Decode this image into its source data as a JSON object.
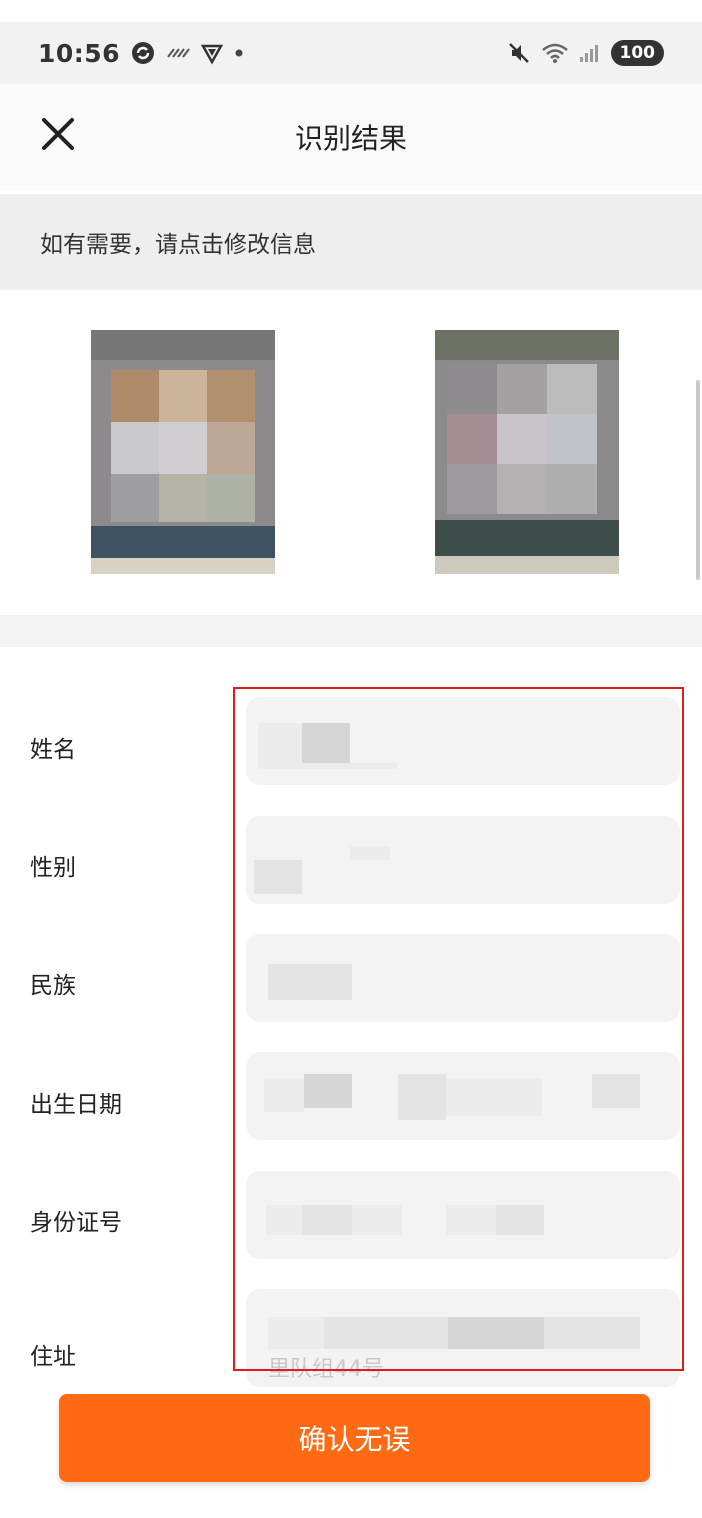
{
  "status_bar": {
    "time": "10:56",
    "battery": "100",
    "icons_left": [
      "sync-icon",
      "wave-icon",
      "shield-icon",
      "dot-icon"
    ],
    "icons_right": [
      "mute-icon",
      "wifi-icon",
      "signal-icon"
    ]
  },
  "header": {
    "title": "识别结果",
    "close_icon": "close-icon"
  },
  "hint": {
    "text": "如有需要，请点击修改信息"
  },
  "id_images": [
    "id-card-front-image",
    "id-card-back-image"
  ],
  "form": {
    "fields": [
      {
        "label": "姓名",
        "value": ""
      },
      {
        "label": "性别",
        "value": ""
      },
      {
        "label": "民族",
        "value": ""
      },
      {
        "label": "出生日期",
        "value": ""
      },
      {
        "label": "身份证号",
        "value": ""
      },
      {
        "label": "住址",
        "value": "",
        "visible_fragment": "里队组44号"
      }
    ]
  },
  "confirm_button": {
    "label": "确认无误"
  },
  "colors": {
    "accent": "#ff6a13",
    "highlight": "#e01b1b"
  }
}
